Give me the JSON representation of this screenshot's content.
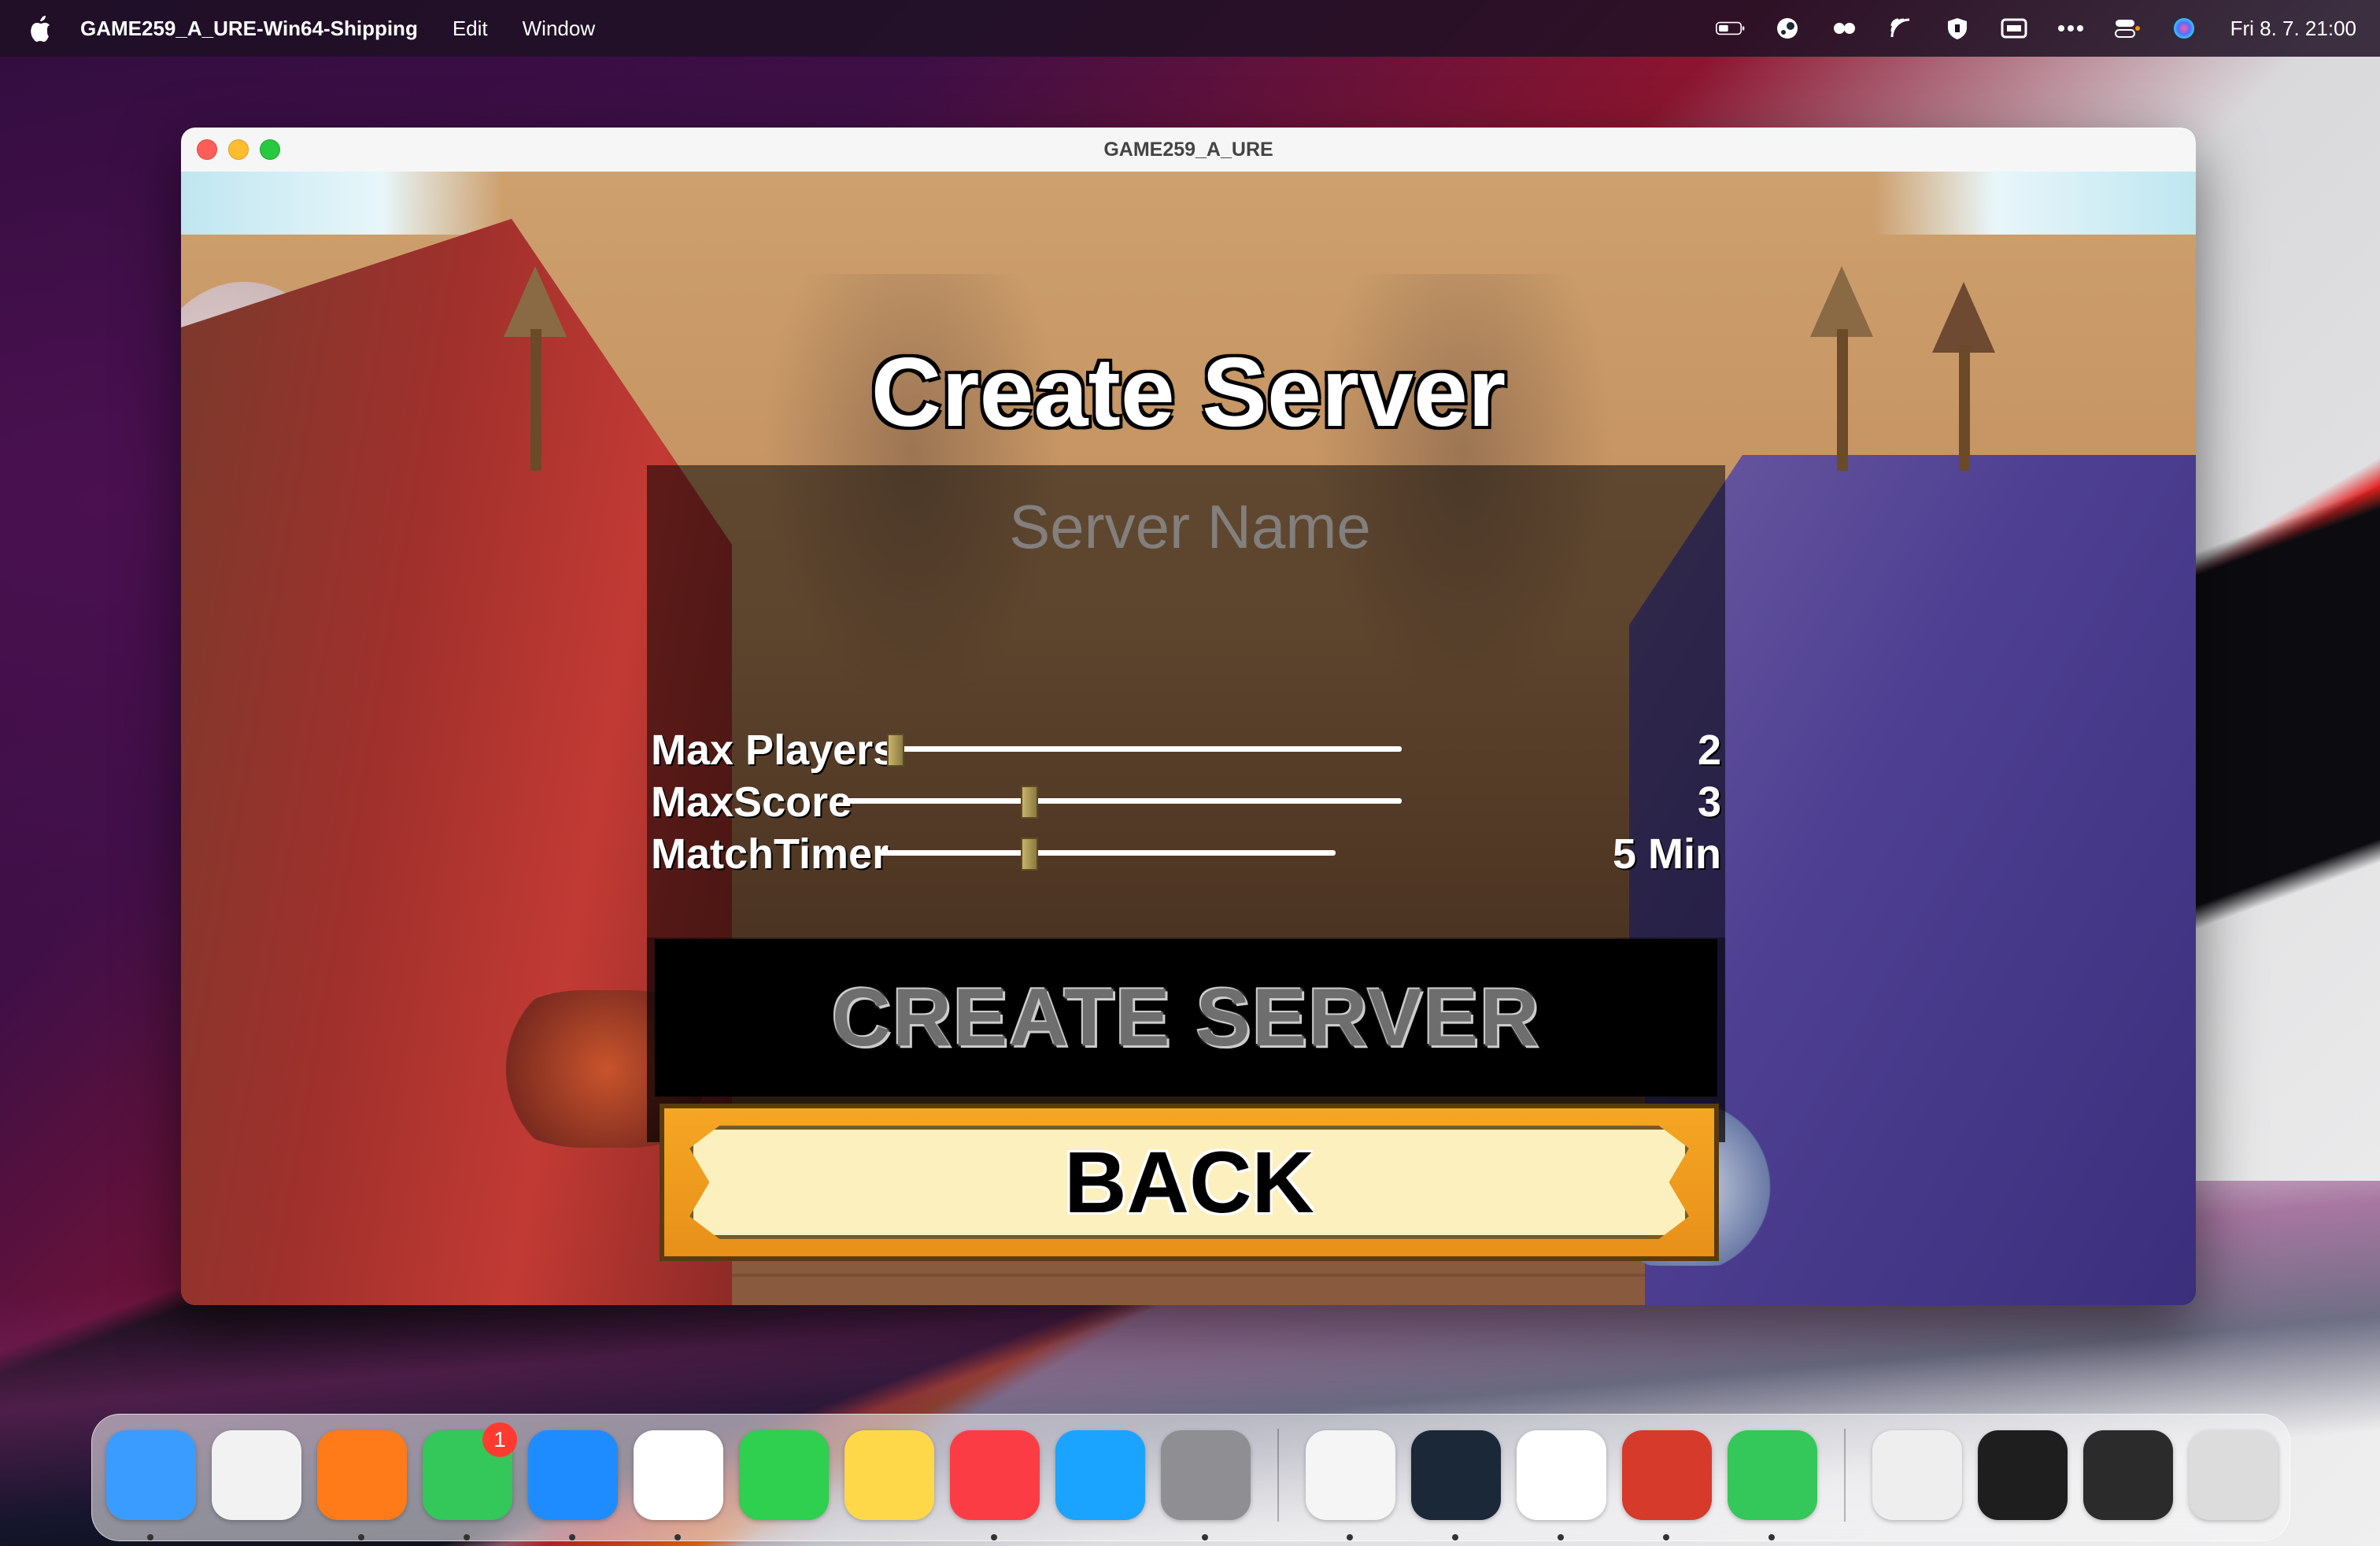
{
  "menubar": {
    "app_name": "GAME259_A_URE-Win64-Shipping",
    "items": [
      "Edit",
      "Window"
    ],
    "clock": "Fri 8. 7.  21:00"
  },
  "tray_icons": [
    "battery-icon",
    "steam-icon",
    "dots-icon",
    "airplay-icon",
    "shield-icon",
    "screen-icon",
    "more-icon",
    "control-center-icon",
    "siri-icon"
  ],
  "window": {
    "title": "GAME259_A_URE"
  },
  "game": {
    "heading": "Create Server",
    "server_name_placeholder": "Server Name",
    "sliders": [
      {
        "label": "Max Players",
        "value": "2",
        "fraction": 0.0
      },
      {
        "label": "MaxScore",
        "value": "3",
        "fraction": 0.22
      },
      {
        "label": "MatchTimer",
        "value": "5 Min",
        "fraction": 0.2
      }
    ],
    "create_button": "CREATE SERVER",
    "back_button": "BACK"
  },
  "dock": {
    "apps": [
      {
        "name": "finder-icon",
        "color": "#3b9cff",
        "running": true
      },
      {
        "name": "launchpad-icon",
        "color": "#f2f2f2",
        "running": false
      },
      {
        "name": "firefox-icon",
        "color": "#ff7a18",
        "running": true
      },
      {
        "name": "messages-icon",
        "color": "#34c759",
        "running": true,
        "badge": "1"
      },
      {
        "name": "mail-icon",
        "color": "#1e8cff",
        "running": true
      },
      {
        "name": "photos-icon",
        "color": "#ffffff",
        "running": true
      },
      {
        "name": "facetime-icon",
        "color": "#2fcf4f",
        "running": false
      },
      {
        "name": "notes-icon",
        "color": "#ffd84a",
        "running": false
      },
      {
        "name": "music-icon",
        "color": "#fc3c44",
        "running": true
      },
      {
        "name": "app-store-icon",
        "color": "#1aa3ff",
        "running": false
      },
      {
        "name": "system-settings-icon",
        "color": "#8e8e93",
        "running": true
      },
      {
        "name": "unreal-engine-icon",
        "color": "#f5f5f5",
        "running": true
      },
      {
        "name": "steam-icon",
        "color": "#1b2838",
        "running": true
      },
      {
        "name": "vscode-icon",
        "color": "#ffffff",
        "running": true
      },
      {
        "name": "game-icon",
        "color": "#d63a2a",
        "running": true
      },
      {
        "name": "messages-alt-icon",
        "color": "#34c759",
        "running": true
      },
      {
        "name": "document-icon",
        "color": "#eeeeee",
        "running": false
      },
      {
        "name": "terminal-window-icon",
        "color": "#1e1e1e",
        "running": false
      },
      {
        "name": "terminal-vscode-window-icon",
        "color": "#2b2b2b",
        "running": false
      },
      {
        "name": "trash-icon",
        "color": "#dcdcdc",
        "running": false
      }
    ]
  }
}
